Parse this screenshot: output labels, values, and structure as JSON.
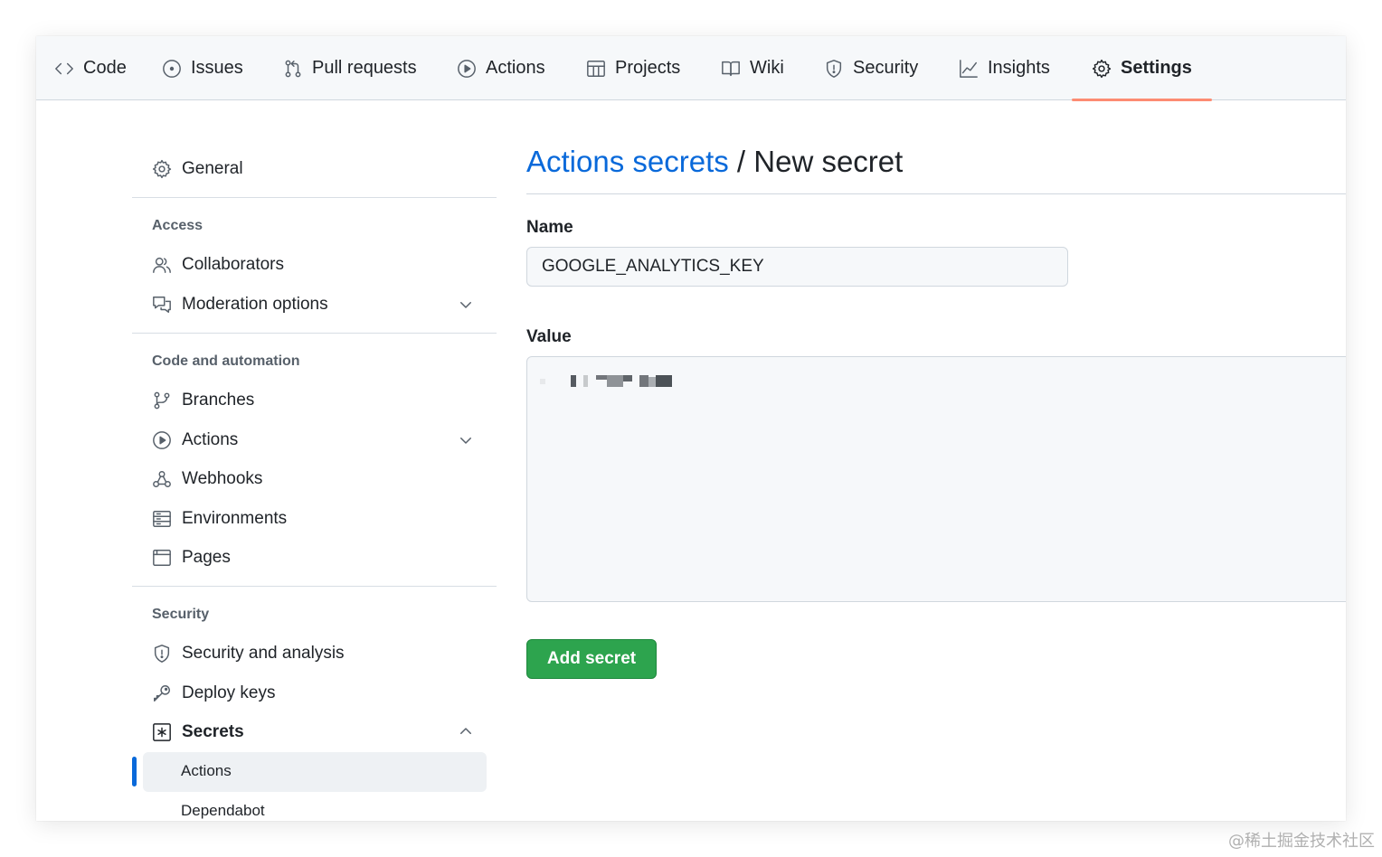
{
  "nav": {
    "tabs": [
      {
        "label": "Code",
        "icon": "code-icon"
      },
      {
        "label": "Issues",
        "icon": "issue-icon"
      },
      {
        "label": "Pull requests",
        "icon": "pull-request-icon"
      },
      {
        "label": "Actions",
        "icon": "play-icon"
      },
      {
        "label": "Projects",
        "icon": "table-icon"
      },
      {
        "label": "Wiki",
        "icon": "book-icon"
      },
      {
        "label": "Security",
        "icon": "shield-icon"
      },
      {
        "label": "Insights",
        "icon": "graph-icon"
      },
      {
        "label": "Settings",
        "icon": "gear-icon",
        "active": true
      }
    ]
  },
  "sidebar": {
    "general": "General",
    "sections": [
      {
        "heading": "Access",
        "items": [
          "Collaborators",
          "Moderation options"
        ]
      },
      {
        "heading": "Code and automation",
        "items": [
          "Branches",
          "Actions",
          "Webhooks",
          "Environments",
          "Pages"
        ]
      },
      {
        "heading": "Security",
        "items": [
          "Security and analysis",
          "Deploy keys",
          "Secrets"
        ]
      }
    ],
    "secrets_sub": [
      "Actions",
      "Dependabot"
    ]
  },
  "main": {
    "breadcrumb_link": "Actions secrets",
    "separator": "/",
    "title": "New secret",
    "name_label": "Name",
    "name_value": "GOOGLE_ANALYTICS_KEY",
    "value_label": "Value",
    "submit_label": "Add secret"
  },
  "watermark": "@稀土掘金技术社区",
  "colors": {
    "accent": "#0969da",
    "active_tab_underline": "#fd8c73",
    "primary_button": "#2da44e"
  }
}
